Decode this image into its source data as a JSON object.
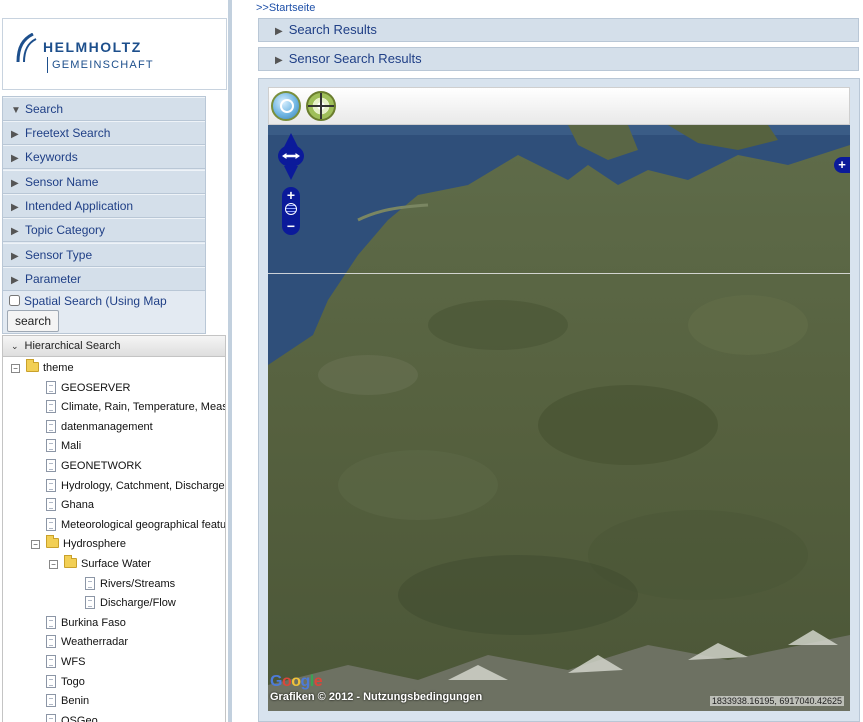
{
  "logo": {
    "line1": "HELMHOLTZ",
    "line2": "GEMEINSCHAFT"
  },
  "search_panel": {
    "header": "Search",
    "items": [
      "Freetext Search",
      "Keywords",
      "Sensor Name",
      "Intended Application",
      "Topic Category",
      "Sensor Type",
      "Parameter"
    ],
    "spatial_label": "Spatial Search (Using Map Extent)",
    "spatial_checked": false,
    "search_button": "search"
  },
  "hierarchical": {
    "title": "Hierarchical Search",
    "tree": [
      {
        "label": "theme",
        "kind": "folder",
        "depth": 0,
        "expanded": true
      },
      {
        "label": "GEOSERVER",
        "kind": "doc",
        "depth": 1
      },
      {
        "label": "Climate, Rain, Temperature, Measure",
        "kind": "doc",
        "depth": 1
      },
      {
        "label": "datenmanagement",
        "kind": "doc",
        "depth": 1
      },
      {
        "label": "Mali",
        "kind": "doc",
        "depth": 1
      },
      {
        "label": "GEONETWORK",
        "kind": "doc",
        "depth": 1
      },
      {
        "label": "Hydrology, Catchment, Discharge, Ga",
        "kind": "doc",
        "depth": 1
      },
      {
        "label": "Ghana",
        "kind": "doc",
        "depth": 1
      },
      {
        "label": "Meteorological geographical features",
        "kind": "doc",
        "depth": 1
      },
      {
        "label": "Hydrosphere",
        "kind": "folder",
        "depth": 1,
        "expanded": true
      },
      {
        "label": "Surface Water",
        "kind": "folder",
        "depth": 2,
        "expanded": true
      },
      {
        "label": "Rivers/Streams",
        "kind": "doc",
        "depth": 3
      },
      {
        "label": "Discharge/Flow",
        "kind": "doc",
        "depth": 3
      },
      {
        "label": "Burkina Faso",
        "kind": "doc",
        "depth": 1
      },
      {
        "label": "Weatherradar",
        "kind": "doc",
        "depth": 1
      },
      {
        "label": "WFS",
        "kind": "doc",
        "depth": 1
      },
      {
        "label": "Togo",
        "kind": "doc",
        "depth": 1
      },
      {
        "label": "Benin",
        "kind": "doc",
        "depth": 1
      },
      {
        "label": "OSGeo",
        "kind": "doc",
        "depth": 1
      }
    ]
  },
  "breadcrumb": ">>Startseite",
  "results_bars": [
    "Search Results",
    "Sensor Search Results"
  ],
  "map": {
    "google_logo": "Google",
    "attribution": "Grafiken © 2012 - Nutzungsbedingungen",
    "coordinates": "1833938.16195, 6917040.42625",
    "colors": {
      "nav_control": "#0b1a9a",
      "sea": "#2f4f7a",
      "land": "#5a6645"
    }
  }
}
